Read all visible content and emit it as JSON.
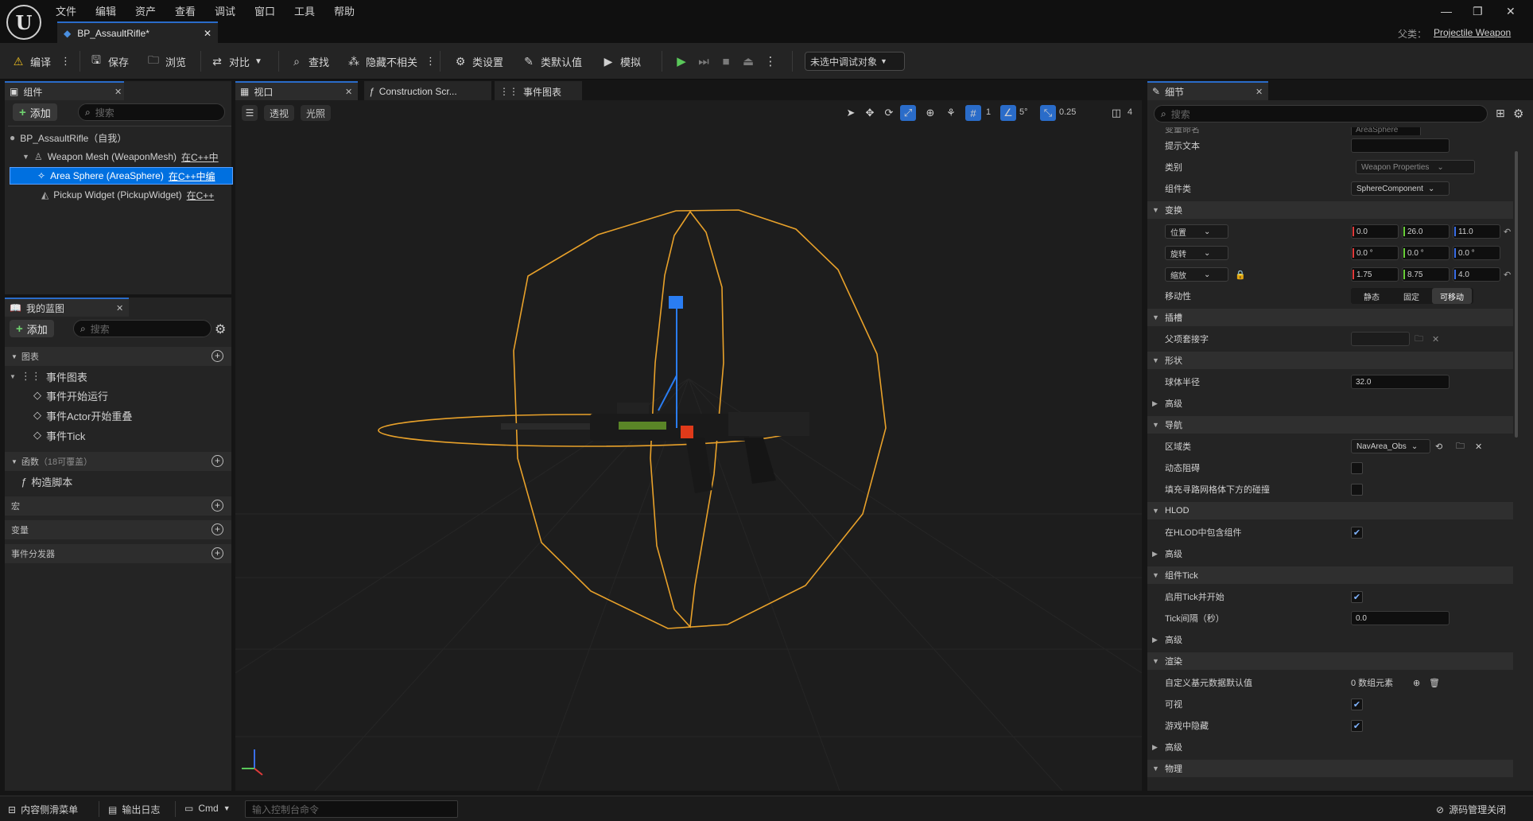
{
  "menu": {
    "file": "文件",
    "edit": "编辑",
    "asset": "资产",
    "view": "查看",
    "debug": "调试",
    "window": "窗口",
    "tools": "工具",
    "help": "帮助"
  },
  "document_tab": {
    "label": "BP_AssaultRifle*"
  },
  "parent_class": {
    "label": "父类：",
    "value": "Projectile Weapon"
  },
  "toolbar": {
    "compile": "编译",
    "save": "保存",
    "browse": "浏览",
    "diff": "对比",
    "find": "查找",
    "hide_unrelated": "隐藏不相关",
    "class_settings": "类设置",
    "class_defaults": "类默认值",
    "simulate": "模拟",
    "debug_target": "未选中调试对象"
  },
  "components": {
    "tab": "组件",
    "add": "添加",
    "search_placeholder": "搜索",
    "items": [
      {
        "label": "BP_AssaultRifle（自我）",
        "note": ""
      },
      {
        "label": "Weapon Mesh (WeaponMesh)",
        "note": "在C++中"
      },
      {
        "label": "Area Sphere (AreaSphere)",
        "note": "在C++中编"
      },
      {
        "label": "Pickup Widget (PickupWidget)",
        "note": "在C++"
      }
    ]
  },
  "my_blueprint": {
    "tab": "我的蓝图",
    "add": "添加",
    "search_placeholder": "搜索",
    "graphs_header": "图表",
    "event_graph": "事件图表",
    "events": [
      "事件开始运行",
      "事件Actor开始重叠",
      "事件Tick"
    ],
    "functions_header": "函数",
    "functions_count": "（18可覆盖）",
    "construction_script": "构造脚本",
    "macros_header": "宏",
    "variables_header": "变量",
    "dispatchers_header": "事件分发器"
  },
  "center_tabs": {
    "viewport": "视口",
    "construction": "Construction Scr...",
    "event_graph": "事件图表"
  },
  "viewport": {
    "perspective": "透视",
    "lit": "光照",
    "grid_snap": "1",
    "rot_snap": "5°",
    "scale_snap": "0.25",
    "camera_speed": "4"
  },
  "details": {
    "tab": "细节",
    "search_placeholder": "搜索",
    "variable_name_label": "变量命名",
    "variable_name_value": "AreaSphere",
    "tooltip_label": "提示文本",
    "category_label": "类别",
    "category_value": "Weapon Properties",
    "component_class_label": "组件类",
    "component_class_value": "SphereComponent",
    "transform_header": "变换",
    "location_label": "位置",
    "location": [
      "0.0",
      "26.0",
      "11.0"
    ],
    "rotation_label": "旋转",
    "rotation": [
      "0.0 °",
      "0.0 °",
      "0.0 °"
    ],
    "scale_label": "缩放",
    "scale": [
      "1.75",
      "8.75",
      "4.0"
    ],
    "mobility_label": "移动性",
    "mobility_options": [
      "静态",
      "固定",
      "可移动"
    ],
    "sockets_header": "插槽",
    "parent_socket_label": "父项套接字",
    "shape_header": "形状",
    "sphere_radius_label": "球体半径",
    "sphere_radius_value": "32.0",
    "advanced": "高级",
    "navigation_header": "导航",
    "area_class_label": "区域类",
    "area_class_value": "NavArea_Obs",
    "dynamic_obstacle_label": "动态阻碍",
    "fill_collision_label": "填充寻路网格体下方的碰撞",
    "hlod_header": "HLOD",
    "include_in_hlod_label": "在HLOD中包含组件",
    "component_tick_header": "组件Tick",
    "start_with_tick_label": "启用Tick并开始",
    "tick_interval_label": "Tick间隔（秒）",
    "tick_interval_value": "0.0",
    "rendering_header": "渲染",
    "custom_primitive_label": "自定义基元数据默认值",
    "custom_primitive_value": "0 数组元素",
    "visible_label": "可视",
    "hidden_in_game_label": "游戏中隐藏",
    "physics_header": "物理"
  },
  "statusbar": {
    "content_drawer": "内容侧滑菜单",
    "output_log": "输出日志",
    "cmd": "Cmd",
    "console_placeholder": "输入控制台命令",
    "source_control": "源码管理关闭"
  },
  "colors": {
    "accent": "#2a6cc9",
    "selection": "#0070e0",
    "sphere": "#e8a12a",
    "play": "#5ac85a"
  }
}
